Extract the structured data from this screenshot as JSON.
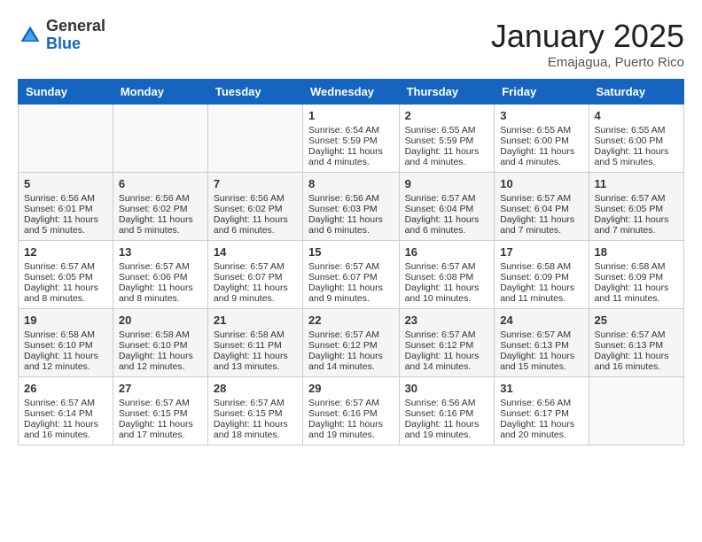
{
  "header": {
    "logo_general": "General",
    "logo_blue": "Blue",
    "month_title": "January 2025",
    "location": "Emajagua, Puerto Rico"
  },
  "weekdays": [
    "Sunday",
    "Monday",
    "Tuesday",
    "Wednesday",
    "Thursday",
    "Friday",
    "Saturday"
  ],
  "weeks": [
    [
      {
        "day": "",
        "content": ""
      },
      {
        "day": "",
        "content": ""
      },
      {
        "day": "",
        "content": ""
      },
      {
        "day": "1",
        "content": "Sunrise: 6:54 AM\nSunset: 5:59 PM\nDaylight: 11 hours and 4 minutes."
      },
      {
        "day": "2",
        "content": "Sunrise: 6:55 AM\nSunset: 5:59 PM\nDaylight: 11 hours and 4 minutes."
      },
      {
        "day": "3",
        "content": "Sunrise: 6:55 AM\nSunset: 6:00 PM\nDaylight: 11 hours and 4 minutes."
      },
      {
        "day": "4",
        "content": "Sunrise: 6:55 AM\nSunset: 6:00 PM\nDaylight: 11 hours and 5 minutes."
      }
    ],
    [
      {
        "day": "5",
        "content": "Sunrise: 6:56 AM\nSunset: 6:01 PM\nDaylight: 11 hours and 5 minutes."
      },
      {
        "day": "6",
        "content": "Sunrise: 6:56 AM\nSunset: 6:02 PM\nDaylight: 11 hours and 5 minutes."
      },
      {
        "day": "7",
        "content": "Sunrise: 6:56 AM\nSunset: 6:02 PM\nDaylight: 11 hours and 6 minutes."
      },
      {
        "day": "8",
        "content": "Sunrise: 6:56 AM\nSunset: 6:03 PM\nDaylight: 11 hours and 6 minutes."
      },
      {
        "day": "9",
        "content": "Sunrise: 6:57 AM\nSunset: 6:04 PM\nDaylight: 11 hours and 6 minutes."
      },
      {
        "day": "10",
        "content": "Sunrise: 6:57 AM\nSunset: 6:04 PM\nDaylight: 11 hours and 7 minutes."
      },
      {
        "day": "11",
        "content": "Sunrise: 6:57 AM\nSunset: 6:05 PM\nDaylight: 11 hours and 7 minutes."
      }
    ],
    [
      {
        "day": "12",
        "content": "Sunrise: 6:57 AM\nSunset: 6:05 PM\nDaylight: 11 hours and 8 minutes."
      },
      {
        "day": "13",
        "content": "Sunrise: 6:57 AM\nSunset: 6:06 PM\nDaylight: 11 hours and 8 minutes."
      },
      {
        "day": "14",
        "content": "Sunrise: 6:57 AM\nSunset: 6:07 PM\nDaylight: 11 hours and 9 minutes."
      },
      {
        "day": "15",
        "content": "Sunrise: 6:57 AM\nSunset: 6:07 PM\nDaylight: 11 hours and 9 minutes."
      },
      {
        "day": "16",
        "content": "Sunrise: 6:57 AM\nSunset: 6:08 PM\nDaylight: 11 hours and 10 minutes."
      },
      {
        "day": "17",
        "content": "Sunrise: 6:58 AM\nSunset: 6:09 PM\nDaylight: 11 hours and 11 minutes."
      },
      {
        "day": "18",
        "content": "Sunrise: 6:58 AM\nSunset: 6:09 PM\nDaylight: 11 hours and 11 minutes."
      }
    ],
    [
      {
        "day": "19",
        "content": "Sunrise: 6:58 AM\nSunset: 6:10 PM\nDaylight: 11 hours and 12 minutes."
      },
      {
        "day": "20",
        "content": "Sunrise: 6:58 AM\nSunset: 6:10 PM\nDaylight: 11 hours and 12 minutes."
      },
      {
        "day": "21",
        "content": "Sunrise: 6:58 AM\nSunset: 6:11 PM\nDaylight: 11 hours and 13 minutes."
      },
      {
        "day": "22",
        "content": "Sunrise: 6:57 AM\nSunset: 6:12 PM\nDaylight: 11 hours and 14 minutes."
      },
      {
        "day": "23",
        "content": "Sunrise: 6:57 AM\nSunset: 6:12 PM\nDaylight: 11 hours and 14 minutes."
      },
      {
        "day": "24",
        "content": "Sunrise: 6:57 AM\nSunset: 6:13 PM\nDaylight: 11 hours and 15 minutes."
      },
      {
        "day": "25",
        "content": "Sunrise: 6:57 AM\nSunset: 6:13 PM\nDaylight: 11 hours and 16 minutes."
      }
    ],
    [
      {
        "day": "26",
        "content": "Sunrise: 6:57 AM\nSunset: 6:14 PM\nDaylight: 11 hours and 16 minutes."
      },
      {
        "day": "27",
        "content": "Sunrise: 6:57 AM\nSunset: 6:15 PM\nDaylight: 11 hours and 17 minutes."
      },
      {
        "day": "28",
        "content": "Sunrise: 6:57 AM\nSunset: 6:15 PM\nDaylight: 11 hours and 18 minutes."
      },
      {
        "day": "29",
        "content": "Sunrise: 6:57 AM\nSunset: 6:16 PM\nDaylight: 11 hours and 19 minutes."
      },
      {
        "day": "30",
        "content": "Sunrise: 6:56 AM\nSunset: 6:16 PM\nDaylight: 11 hours and 19 minutes."
      },
      {
        "day": "31",
        "content": "Sunrise: 6:56 AM\nSunset: 6:17 PM\nDaylight: 11 hours and 20 minutes."
      },
      {
        "day": "",
        "content": ""
      }
    ]
  ]
}
